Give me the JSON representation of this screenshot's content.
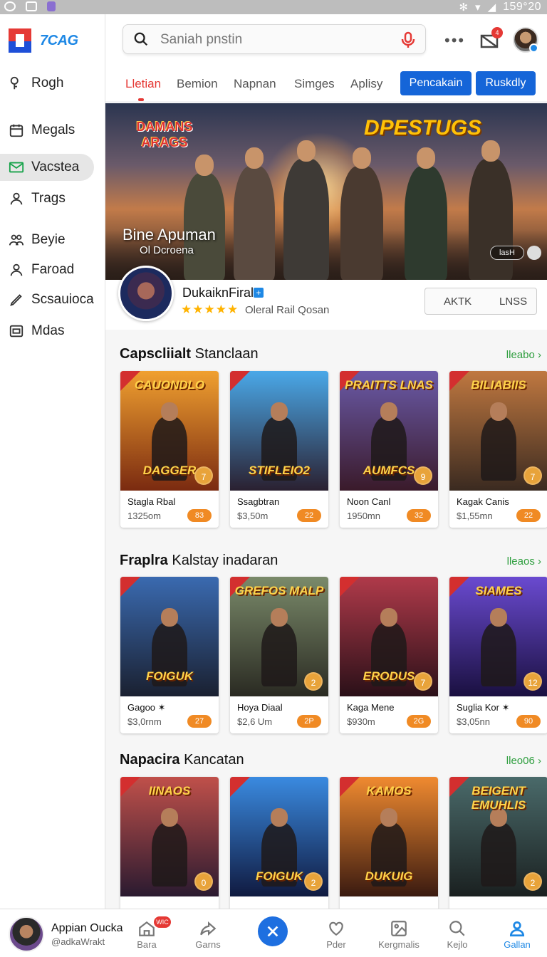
{
  "status_bar": {
    "time": "159°20"
  },
  "app": {
    "logo_text": "7CAG"
  },
  "sidebar": {
    "items": [
      {
        "label": "Rogh",
        "icon": "key-icon"
      },
      {
        "label": "Megals",
        "icon": "calendar-icon"
      },
      {
        "label": "Vacstea",
        "icon": "mail-icon",
        "active": true
      },
      {
        "label": "Trags",
        "icon": "user-icon"
      },
      {
        "label": "Beyie",
        "icon": "users-icon"
      },
      {
        "label": "Faroad",
        "icon": "user-icon"
      },
      {
        "label": "Scsauioca",
        "icon": "pen-icon"
      },
      {
        "label": "Mdas",
        "icon": "image-icon"
      }
    ]
  },
  "header": {
    "search_placeholder": "Saniah pnstin",
    "notification_count": "4",
    "more_label": "•••"
  },
  "tabs": {
    "items": [
      "Lletian",
      "Bemion",
      "Napnan",
      "Simges",
      "Aplisy"
    ],
    "active_index": 0,
    "button_primary": "Pencakain",
    "button_secondary": "Ruskdly"
  },
  "hero": {
    "logo_left": "DAMANS ARAGS",
    "logo_right": "DPESTUGS",
    "title": "Bine Apuman",
    "subtitle": "Ol Dcroena",
    "badge": "lasH"
  },
  "featured": {
    "name": "DukaiknFiral",
    "stars": "★★★★★",
    "meta": "Oleral Rail Qosan",
    "button_left": "AKTK",
    "button_right": "LNSS"
  },
  "sections": [
    {
      "title_bold": "Capscliialt",
      "title_rest": "Stanclaan",
      "more": "lleabo",
      "cards": [
        {
          "art_text": "CAUONDLO",
          "art_text2": "DAGGER",
          "name": "Stagla Rbal",
          "price": "1325om",
          "badge": "83",
          "num": "7",
          "colors": [
            "#f0a030",
            "#7a2a10"
          ]
        },
        {
          "art_text": "",
          "art_text2": "STIFLEIO2",
          "name": "Ssagbtran",
          "price": "$3,50m",
          "badge": "22",
          "num": "",
          "colors": [
            "#4aa8e8",
            "#2a2030"
          ]
        },
        {
          "art_text": "PRAITTS LNAS",
          "art_text2": "AUMFCS",
          "name": "Noon Canl",
          "price": "1950mn",
          "badge": "32",
          "num": "9",
          "colors": [
            "#6a5aa8",
            "#3a1a2a"
          ]
        },
        {
          "art_text": "BILIABIIS",
          "art_text2": "",
          "name": "Kagak Canis",
          "price": "$1,55mn",
          "badge": "22",
          "num": "7",
          "colors": [
            "#c07840",
            "#3a2a20"
          ]
        }
      ]
    },
    {
      "title_bold": "Fraplra",
      "title_rest": "Kalstay inadaran",
      "more": "lleaos",
      "cards": [
        {
          "art_text": "",
          "art_text2": "FOIGUK",
          "name": "Gagoo ✶",
          "price": "$3,0rnm",
          "badge": "27",
          "num": "",
          "colors": [
            "#3a6ab0",
            "#1a2030"
          ]
        },
        {
          "art_text": "GREFOS MALP",
          "art_text2": "",
          "name": "Hoya Diaal",
          "price": "$2,6 Um",
          "badge": "2P",
          "num": "2",
          "colors": [
            "#7a8a6a",
            "#2a2a22"
          ]
        },
        {
          "art_text": "",
          "art_text2": "ERODUS",
          "name": "Kaga Mene",
          "price": "$930m",
          "badge": "2G",
          "num": "7",
          "colors": [
            "#b03a4a",
            "#2a1018"
          ]
        },
        {
          "art_text": "SIAMES",
          "art_text2": "",
          "name": "Suglia Kor ✶",
          "price": "$3,05nn",
          "badge": "90",
          "num": "12",
          "colors": [
            "#6a4ad0",
            "#1a1040"
          ]
        }
      ]
    },
    {
      "title_bold": "Napacira",
      "title_rest": "Kancatan",
      "more": "lleo06",
      "cards": [
        {
          "art_text": "IINAOS",
          "art_text2": "",
          "name": "",
          "price": "",
          "badge": "",
          "num": "0",
          "colors": [
            "#c0504a",
            "#2a1a30"
          ]
        },
        {
          "art_text": "",
          "art_text2": "FOIGUK",
          "name": "",
          "price": "",
          "badge": "",
          "num": "2",
          "colors": [
            "#3a8ae0",
            "#101a40"
          ]
        },
        {
          "art_text": "KAMOS",
          "art_text2": "DUKUIG",
          "name": "",
          "price": "",
          "badge": "",
          "num": "",
          "colors": [
            "#f08a30",
            "#3a1a10"
          ]
        },
        {
          "art_text": "BEIGENT EMUHLIS",
          "art_text2": "",
          "name": "",
          "price": "",
          "badge": "",
          "num": "2",
          "colors": [
            "#4a6a6a",
            "#1a2020"
          ]
        }
      ]
    }
  ],
  "bottom_bar": {
    "user_name": "Appian Oucka",
    "user_handle": "@adkaWrakt",
    "badge": "WIC",
    "items": [
      {
        "label": "Bara",
        "icon": "home-icon"
      },
      {
        "label": "Garns",
        "icon": "share-icon"
      },
      {
        "label": "Pder",
        "icon": "heart-icon"
      },
      {
        "label": "Kergmalis",
        "icon": "gallery-icon"
      },
      {
        "label": "Kejlo",
        "icon": "search-icon"
      },
      {
        "label": "Gallan",
        "icon": "profile-icon",
        "active": true
      }
    ]
  }
}
